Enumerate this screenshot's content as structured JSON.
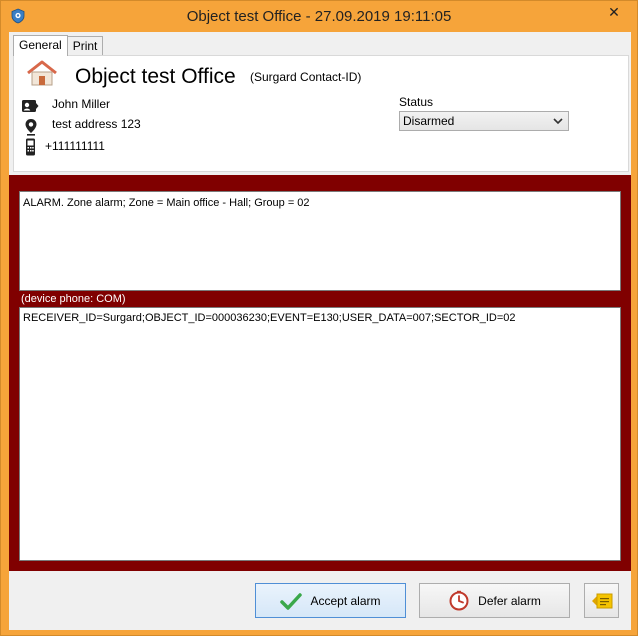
{
  "window": {
    "title": "Object test Office - 27.09.2019 19:11:05",
    "close_glyph": "✕"
  },
  "tabs": [
    {
      "label": "General",
      "active": true
    },
    {
      "label": "Print",
      "active": false
    }
  ],
  "object": {
    "name": "Object test Office",
    "protocol": "(Surgard Contact-ID)",
    "contact_name": "John Miller",
    "address": "test address 123",
    "phone": "+111111111"
  },
  "status": {
    "label": "Status",
    "value": "Disarmed"
  },
  "alarm": {
    "message": "ALARM. Zone alarm; Zone = Main office - Hall; Group = 02",
    "device_phone": "(device phone: COM)",
    "raw": "RECEIVER_ID=Surgard;OBJECT_ID=000036230;EVENT=E130;USER_DATA=007;SECTOR_ID=02"
  },
  "buttons": {
    "accept": "Accept alarm",
    "defer": "Defer alarm"
  },
  "colors": {
    "titlebar": "#f6a43a",
    "alarm_panel": "#800000",
    "accept_check": "#3aa84a",
    "defer_clock": "#c0392b"
  },
  "icons": {
    "app": "shield-icon",
    "house": "house-icon",
    "contact": "contact-card-icon",
    "address": "location-pin-icon",
    "phone": "mobile-phone-icon",
    "accept": "checkmark-icon",
    "defer": "clock-icon",
    "extra": "note-icon"
  }
}
